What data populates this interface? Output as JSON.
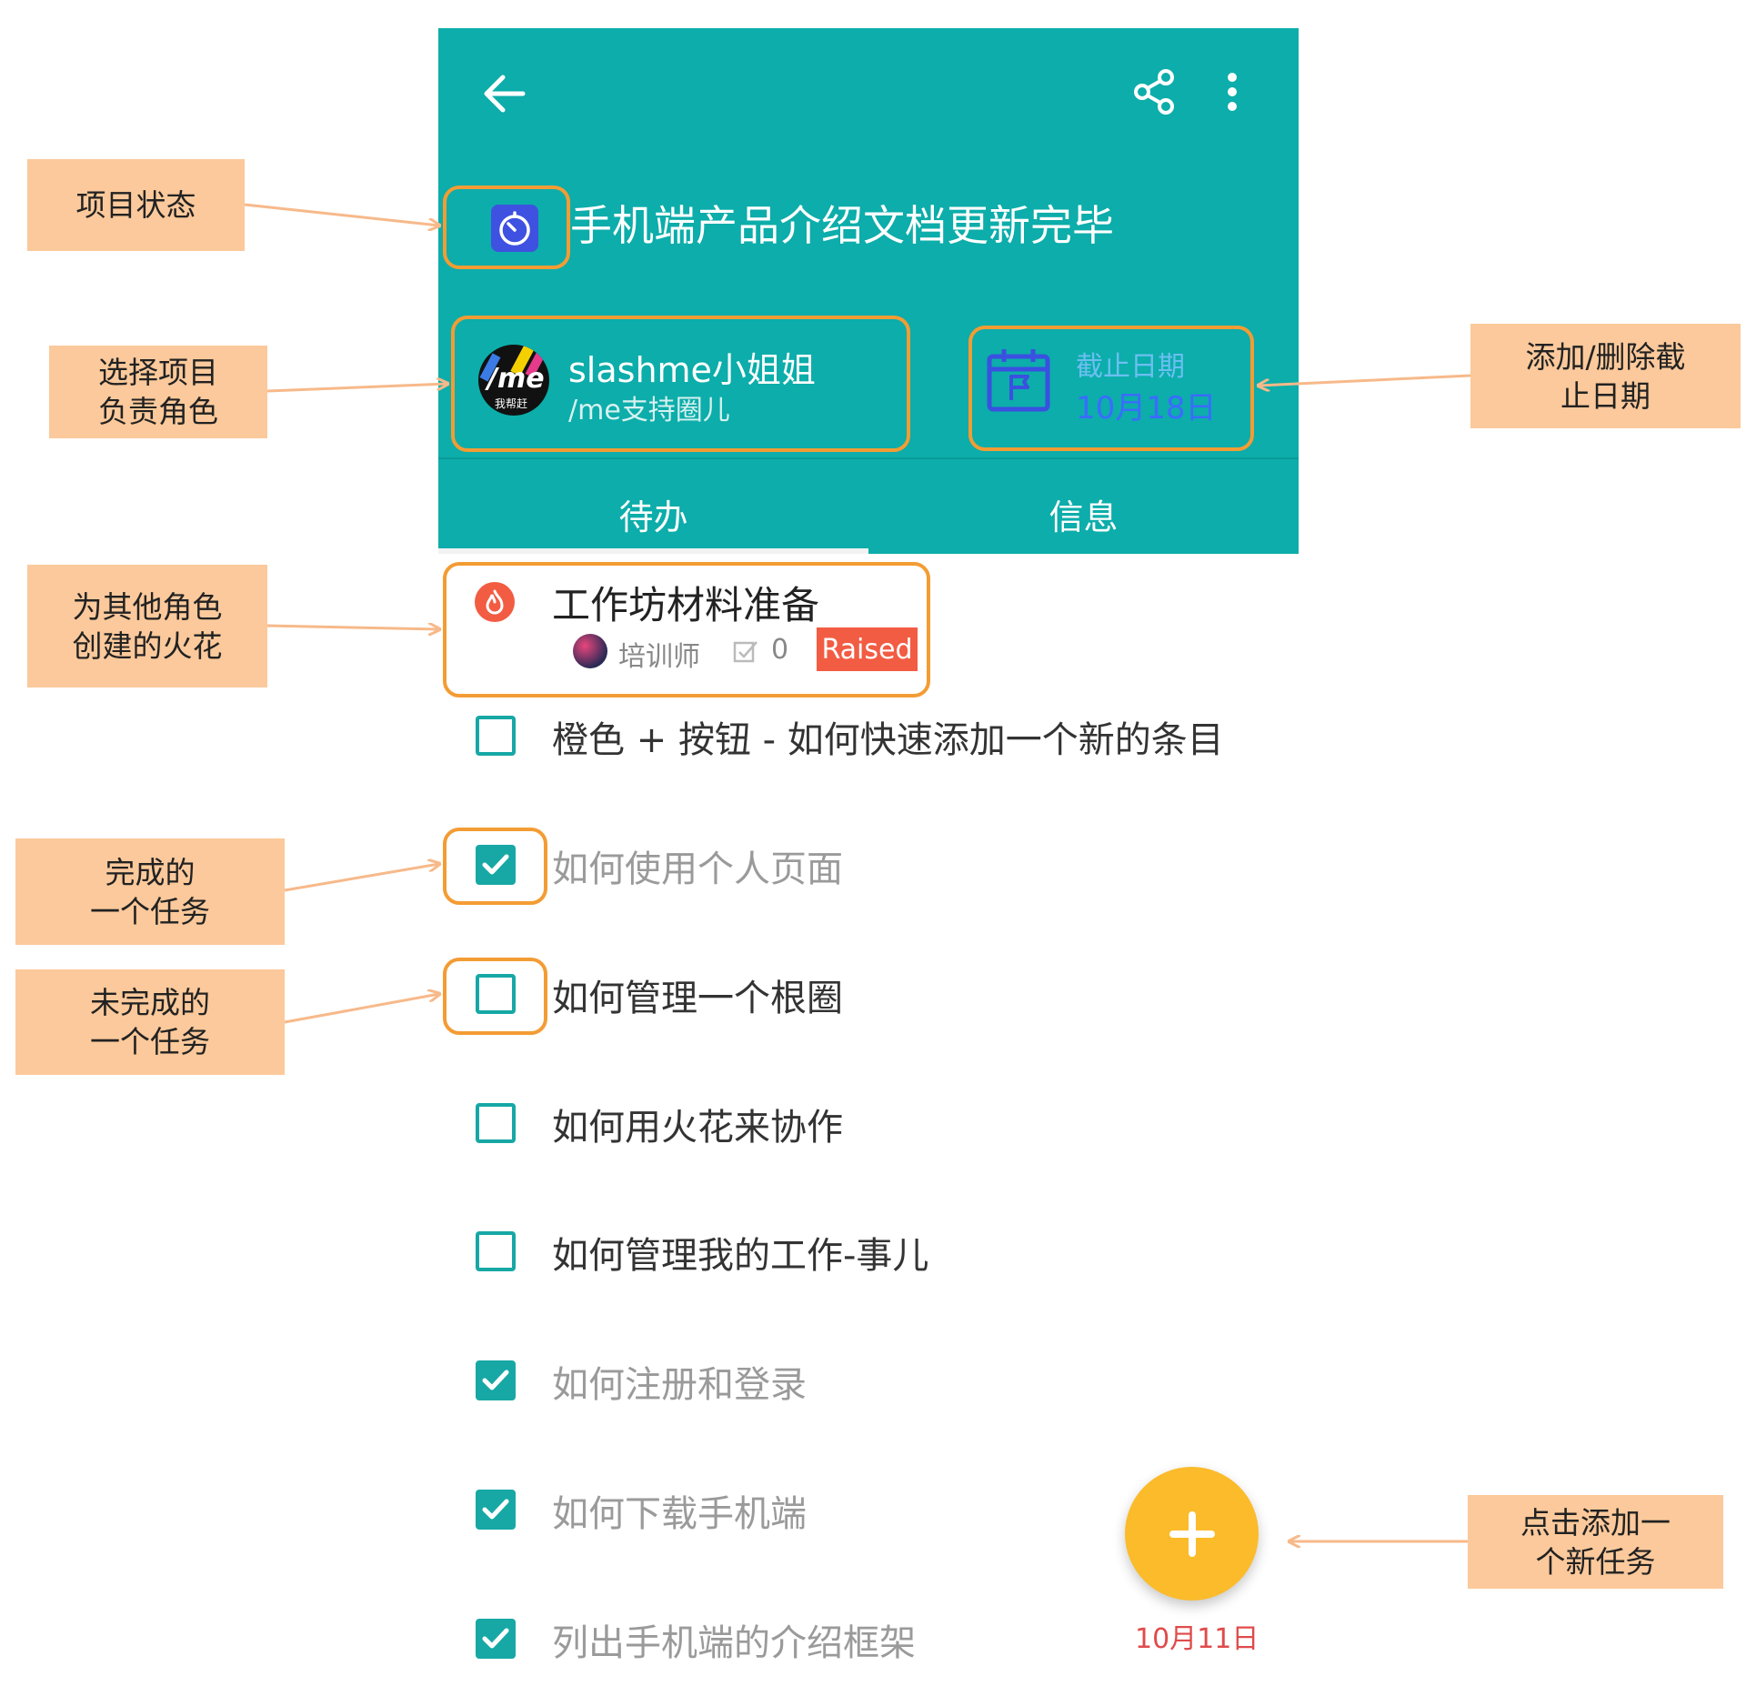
{
  "header": {
    "back_icon": "arrow-left-icon",
    "share_icon": "share-icon",
    "more_icon": "more-vertical-icon",
    "status_icon": "timer-icon",
    "title": "手机端产品介绍文档更新完毕",
    "owner": {
      "name": "slashme小姐姐",
      "circle": "/me支持圈儿",
      "avatar_text": "/me",
      "avatar_sub": "我帮赶"
    },
    "due": {
      "label": "截止日期",
      "value": "10月18日",
      "icon": "calendar-flag-icon"
    },
    "tabs": [
      "待办",
      "信息"
    ],
    "active_tab": 0
  },
  "spark": {
    "icon": "fire-icon",
    "title": "工作坊材料准备",
    "role": "培训师",
    "count": "0",
    "status": "Raised"
  },
  "tasks": [
    {
      "text": "橙色 + 按钮 - 如何快速添加一个新的条目",
      "done": false
    },
    {
      "text": "如何使用个人页面",
      "done": true
    },
    {
      "text": "如何管理一个根圈",
      "done": false
    },
    {
      "text": "如何用火花来协作",
      "done": false
    },
    {
      "text": "如何管理我的工作-事儿",
      "done": false
    },
    {
      "text": "如何注册和登录",
      "done": true
    },
    {
      "text": "如何下载手机端",
      "done": true
    },
    {
      "text": "列出手机端的介绍框架",
      "done": true
    }
  ],
  "fab": {
    "icon": "plus-icon",
    "date": "10月11日"
  },
  "callouts": {
    "status": "项目状态",
    "owner": [
      "选择项目",
      "负责角色"
    ],
    "due": [
      "添加/删除截",
      "止日期"
    ],
    "spark": [
      "为其他角色",
      "创建的火花"
    ],
    "done": [
      "完成的",
      "一个任务"
    ],
    "undone": [
      "未完成的",
      "一个任务"
    ],
    "fab": [
      "点击添加一",
      "个新任务"
    ]
  },
  "colors": {
    "teal": "#0cadaa",
    "orange_highlight": "#f39c34",
    "callout_bg": "#fbc99b",
    "fab": "#fbbb2a",
    "badge": "#f25c43"
  }
}
